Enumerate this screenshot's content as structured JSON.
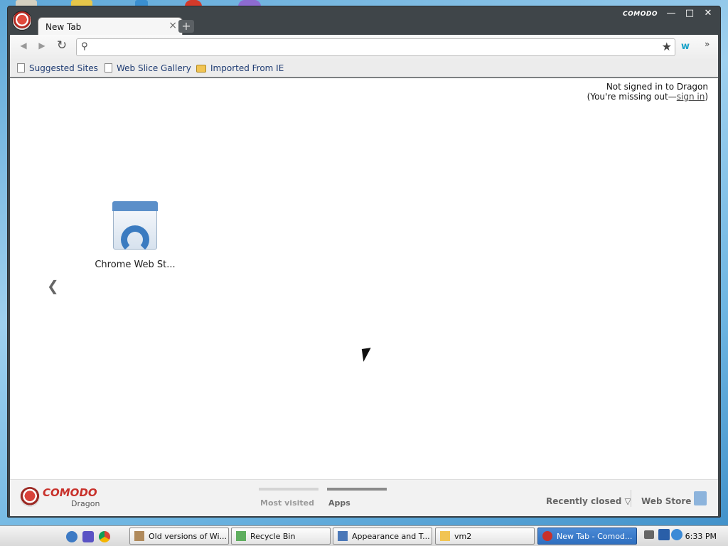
{
  "window": {
    "brand_word": "COMODO",
    "tab_title": "New Tab",
    "tab_close": "×",
    "new_tab_symbol": "+",
    "controls": {
      "minimize": "—",
      "maximize": "□",
      "close": "✕"
    }
  },
  "toolbar": {
    "back": "◀",
    "forward": "▶",
    "reload": "↻",
    "omnibox_value": "",
    "search_glyph": "⚲",
    "bookmark_star": "★",
    "extension_label": "w",
    "more": "»"
  },
  "bookmarks": [
    {
      "label": "Suggested Sites",
      "icon": "page-icon"
    },
    {
      "label": "Web Slice Gallery",
      "icon": "page-icon"
    },
    {
      "label": "Imported From IE",
      "icon": "folder-icon"
    }
  ],
  "signin": {
    "line1": "Not signed in to Dragon",
    "prefix": "(You're missing out—",
    "link": "sign in",
    "suffix": ")"
  },
  "apps": [
    {
      "label": "Chrome Web St..."
    }
  ],
  "nav_prev": "❮",
  "footer": {
    "brand": "COMODO",
    "sub": "Dragon",
    "tabs": [
      {
        "label": "Most visited",
        "active": false
      },
      {
        "label": "Apps",
        "active": true
      }
    ],
    "recently_closed": "Recently closed ▽",
    "web_store": "Web Store"
  },
  "taskbar": {
    "buttons": [
      {
        "label": "Old versions of Wi..."
      },
      {
        "label": "Recycle Bin"
      },
      {
        "label": "Appearance and T..."
      },
      {
        "label": "vm2"
      },
      {
        "label": "New Tab - Comod..."
      }
    ],
    "clock": "6:33 PM"
  },
  "colors": {
    "brand_red": "#c8312b",
    "title_bar": "#3f4549",
    "taskbar_active": "#2f6fbf"
  }
}
